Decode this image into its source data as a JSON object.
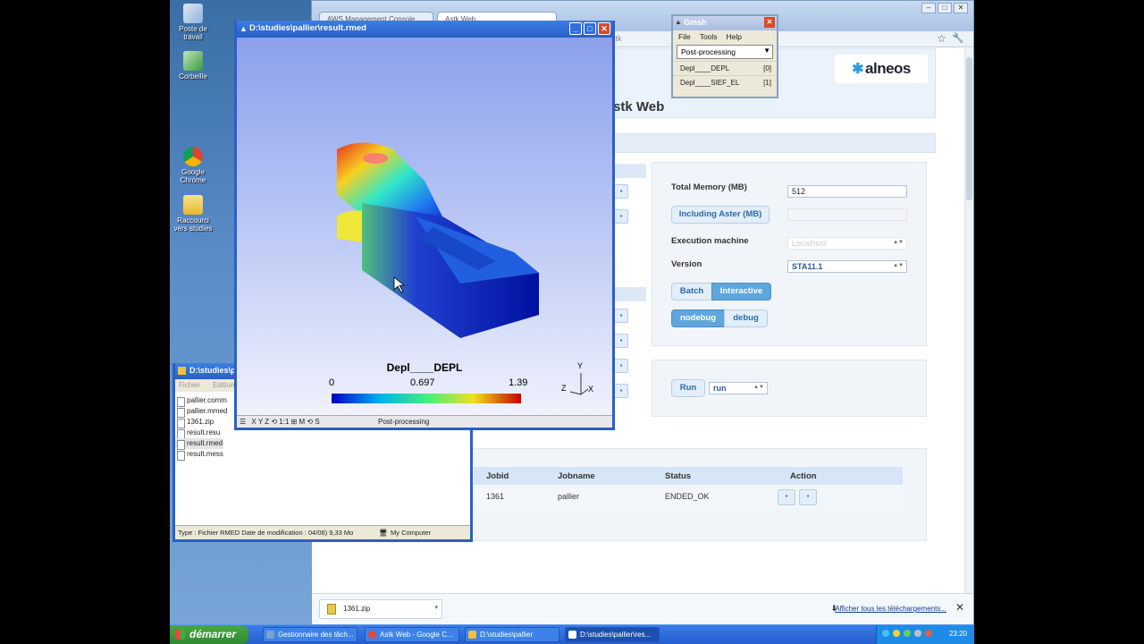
{
  "desktop": {
    "icons": [
      {
        "label": "Poste de travail"
      },
      {
        "label": "Corbeille"
      },
      {
        "label": "Google Chrome"
      },
      {
        "label": "Raccourci vers studies"
      }
    ]
  },
  "browser": {
    "tabs": [
      "AWS Management Console",
      "Astk Web"
    ],
    "url": "astk",
    "page_title": "stk Web",
    "logo_text": "alneos",
    "form": {
      "total_memory_label": "Total Memory (MB)",
      "total_memory_value": "512",
      "including_aster_label": "Including Aster (MB)",
      "execution_machine_label": "Execution machine",
      "execution_machine_value": "Localhost",
      "version_label": "Version",
      "version_value": "STA11.1",
      "batch_label": "Batch",
      "interactive_label": "Interactive",
      "nodebug_label": "nodebug",
      "debug_label": "debug",
      "run_button_label": "Run",
      "run_select_value": "run"
    },
    "jobs_table": {
      "headers": [
        "Jobid",
        "Jobname",
        "Status",
        "Action"
      ],
      "rows": [
        {
          "jobid": "1361",
          "jobname": "pallier",
          "status": "ENDED_OK"
        }
      ]
    },
    "download_bar": {
      "item_name": "1361.zip",
      "show_all_label": "Afficher tous les téléchargements..."
    }
  },
  "explorer": {
    "title": "D:\\studies\\p",
    "menu": [
      "Fichier",
      "Edition"
    ],
    "files": [
      "pallier.comm",
      "pallier.mmed",
      "1361.zip",
      "result.resu",
      "result.rmed",
      "result.mess"
    ],
    "status_text": "Type : Fichier RMED Date de modification : 04/06) 9,33 Mo",
    "status_location": "My Computer"
  },
  "gmsh_window": {
    "title": "D:\\studies\\pallier\\result.rmed",
    "scale_title": "Depl____DEPL",
    "scale_min": "0",
    "scale_mid": "0.697",
    "scale_max": "1.39",
    "axis_labels": {
      "y": "Y",
      "z": "Z",
      "x": "X"
    },
    "toolbar": "X Y Z ⟲ 1:1 ⊞ M ⟲ S",
    "status_text": "Post-processing"
  },
  "gmsh_menu": {
    "title": "Gmsh",
    "menus": [
      "File",
      "Tools",
      "Help"
    ],
    "mode": "Post-processing",
    "views": [
      {
        "label": "Depl____DEPL",
        "index": "[0]"
      },
      {
        "label": "Depl____SIEF_EL",
        "index": "[1]"
      }
    ]
  },
  "taskbar": {
    "start_label": "démarrer",
    "tasks": [
      "Gestionnaire des tâch...",
      "Astk Web - Google C...",
      "D:\\studies\\pallier",
      "D:\\studies\\pallier\\res..."
    ],
    "clock": "23:20"
  },
  "colors": {
    "xp_blue": "#2a5fc8",
    "accent_button": "#5fa6dc",
    "legend_low": "#0000c8",
    "legend_high": "#c80000"
  }
}
